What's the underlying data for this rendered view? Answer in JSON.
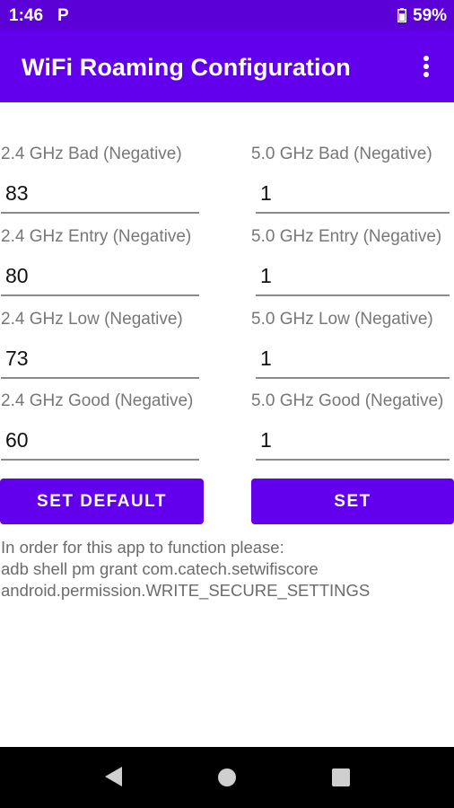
{
  "status_bar": {
    "time": "1:46",
    "notification_glyph": "P",
    "battery": "59%"
  },
  "app_bar": {
    "title": "WiFi Roaming Configuration"
  },
  "fields_24": [
    {
      "label": "2.4 GHz Bad (Negative)",
      "value": "83"
    },
    {
      "label": "2.4 GHz Entry (Negative)",
      "value": "80"
    },
    {
      "label": "2.4 GHz Low (Negative)",
      "value": "73"
    },
    {
      "label": "2.4 GHz Good (Negative)",
      "value": "60"
    }
  ],
  "fields_50": [
    {
      "label": "5.0 GHz Bad (Negative)",
      "value": "1"
    },
    {
      "label": "5.0 GHz Entry (Negative)",
      "value": "1"
    },
    {
      "label": "5.0 GHz Low (Negative)",
      "value": "1"
    },
    {
      "label": "5.0 GHz Good (Negative)",
      "value": "1"
    }
  ],
  "buttons": {
    "set_default": "SET DEFAULT",
    "set": "SET"
  },
  "info": {
    "line1": "In order for this app to function please:",
    "line2": "adb shell pm grant com.catech.setwifiscore",
    "line3": "android.permission.WRITE_SECURE_SETTINGS"
  },
  "colors": {
    "status_bar": "#5b00d6",
    "primary": "#6200ee",
    "nav_bar": "#000000"
  }
}
